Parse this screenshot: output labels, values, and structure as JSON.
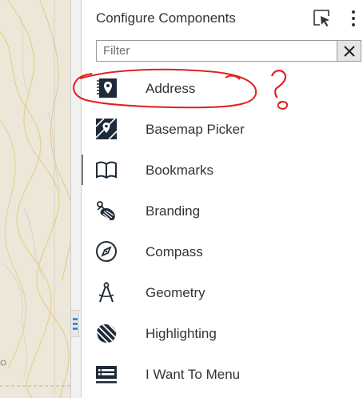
{
  "panel": {
    "title": "Configure Components",
    "select_icon": "select-cursor-icon",
    "more_icon": "more-vertical-icon"
  },
  "filter": {
    "placeholder": "Filter",
    "value": "",
    "clear_label": "×"
  },
  "components": [
    {
      "label": "Address",
      "icon": "address-icon"
    },
    {
      "label": "Basemap Picker",
      "icon": "basemap-icon"
    },
    {
      "label": "Bookmarks",
      "icon": "bookmark-icon"
    },
    {
      "label": "Branding",
      "icon": "branding-icon"
    },
    {
      "label": "Compass",
      "icon": "compass-icon"
    },
    {
      "label": "Geometry",
      "icon": "geometry-icon"
    },
    {
      "label": "Highlighting",
      "icon": "highlighting-icon"
    },
    {
      "label": "I Want To Menu",
      "icon": "menu-icon"
    }
  ],
  "annotation": {
    "text": "?",
    "color": "#e02020"
  },
  "colors": {
    "map_bg": "#ece7d8",
    "contour": "#e6cf8f",
    "grip_dots": "#2b79c8",
    "icon": "#1f2a38"
  }
}
